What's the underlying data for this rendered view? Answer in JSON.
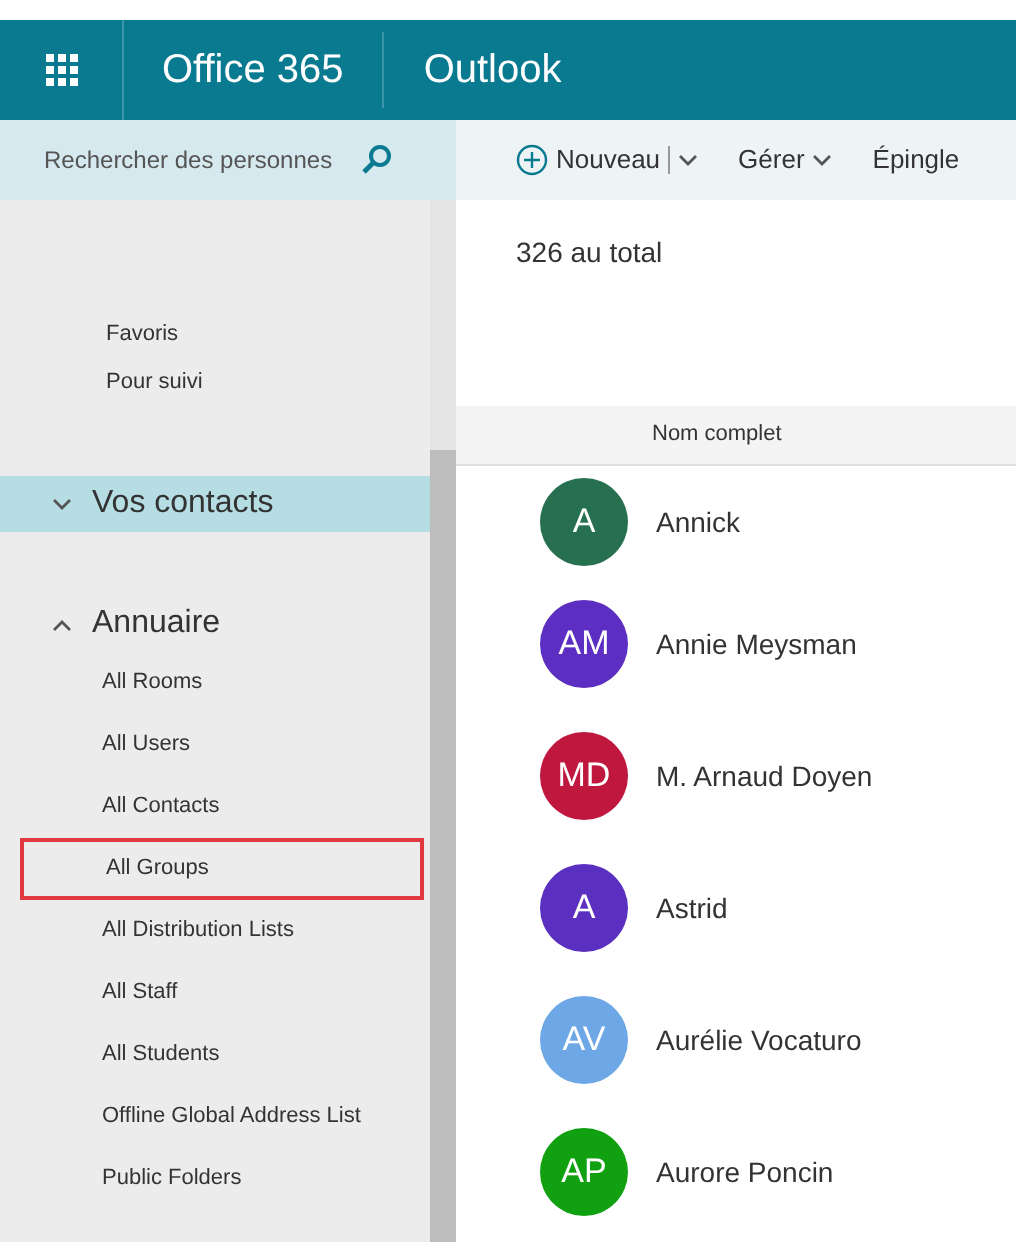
{
  "header": {
    "suite": "Office 365",
    "app": "Outlook"
  },
  "search": {
    "placeholder": "Rechercher des personnes"
  },
  "toolbar": [
    {
      "label": "Nouveau",
      "kind": "new"
    },
    {
      "label": "Gérer",
      "kind": "menu"
    },
    {
      "label": "Épingle",
      "kind": "plain"
    }
  ],
  "sidebar": {
    "favorites": [
      "Favoris",
      "Pour suivi"
    ],
    "sections": [
      {
        "label": "Vos contacts",
        "expanded": false,
        "selected": true
      },
      {
        "label": "Annuaire",
        "expanded": true,
        "selected": false,
        "items": [
          {
            "label": "All Rooms",
            "highlighted": false
          },
          {
            "label": "All Users",
            "highlighted": false
          },
          {
            "label": "All Contacts",
            "highlighted": false
          },
          {
            "label": "All Groups",
            "highlighted": true
          },
          {
            "label": "All Distribution Lists",
            "highlighted": false
          },
          {
            "label": "All Staff",
            "highlighted": false
          },
          {
            "label": "All Students",
            "highlighted": false
          },
          {
            "label": "Offline Global Address List",
            "highlighted": false
          },
          {
            "label": "Public Folders",
            "highlighted": false
          }
        ]
      }
    ]
  },
  "total": "326 au total",
  "table": {
    "columns": [
      "Nom complet"
    ],
    "rows": [
      {
        "initials": "A",
        "name": "Annick",
        "color": "#26704f"
      },
      {
        "initials": "AM",
        "name": "Annie Meysman",
        "color": "#5c2fc2"
      },
      {
        "initials": "MD",
        "name": "M. Arnaud Doyen",
        "color": "#c0173f"
      },
      {
        "initials": "A",
        "name": "Astrid",
        "color": "#5b30c0"
      },
      {
        "initials": "AV",
        "name": "Aurélie Vocaturo",
        "color": "#6ea7e6"
      },
      {
        "initials": "AP",
        "name": "Aurore Poncin",
        "color": "#10a010"
      }
    ]
  }
}
